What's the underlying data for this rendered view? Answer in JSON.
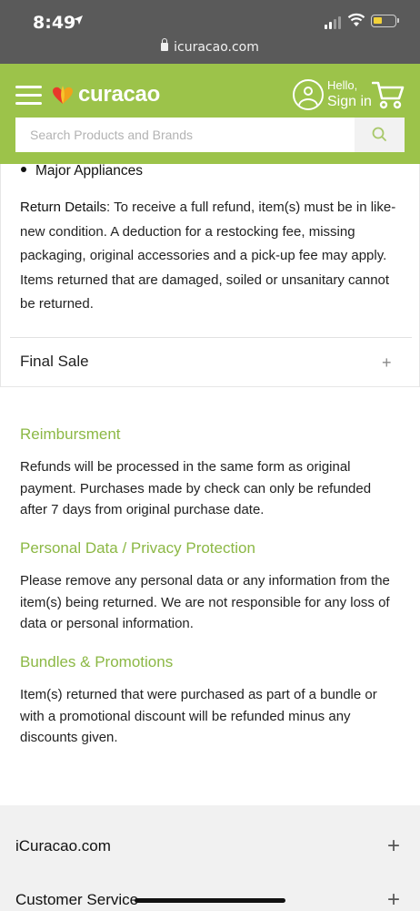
{
  "status_bar": {
    "time": "8:49",
    "url": "icuracao.com",
    "battery_color": "#f2d23a"
  },
  "header": {
    "brand": "curacao",
    "hello": "Hello,",
    "sign_in": "Sign in",
    "search_placeholder": "Search Products and Brands",
    "brand_color": "#9cc34a"
  },
  "content": {
    "bullet_item": "Major Appliances",
    "return_details_label": "Return Details",
    "return_details_text": ": To receive a full refund, item(s) must be in like-new condition. A deduction for a restocking fee, missing packaging, original accessories and a pick-up fee may apply. Items returned that are damaged, soiled or unsanitary cannot be returned.",
    "accordion": {
      "label": "Final Sale",
      "toggle": "+"
    }
  },
  "sections": [
    {
      "title": "Reimbursment",
      "text": "Refunds will be processed in the same form as original payment. Purchases made by check can only be refunded after 7 days from original purchase date."
    },
    {
      "title": "Personal Data / Privacy Protection",
      "text": "Please remove any personal data or any information from the item(s) being returned. We are not responsible for any loss of data or personal information."
    },
    {
      "title": "Bundles & Promotions",
      "text": "Item(s) returned that were purchased as part of a bundle or with a promotional discount will be refunded minus any discounts given."
    }
  ],
  "footer": {
    "items": [
      {
        "label": "iCuracao.com",
        "toggle": "+"
      },
      {
        "label": "Customer Service",
        "toggle": "+"
      }
    ]
  },
  "colors": {
    "accent": "#8cb845",
    "footer_bg": "#f1f1f1"
  }
}
